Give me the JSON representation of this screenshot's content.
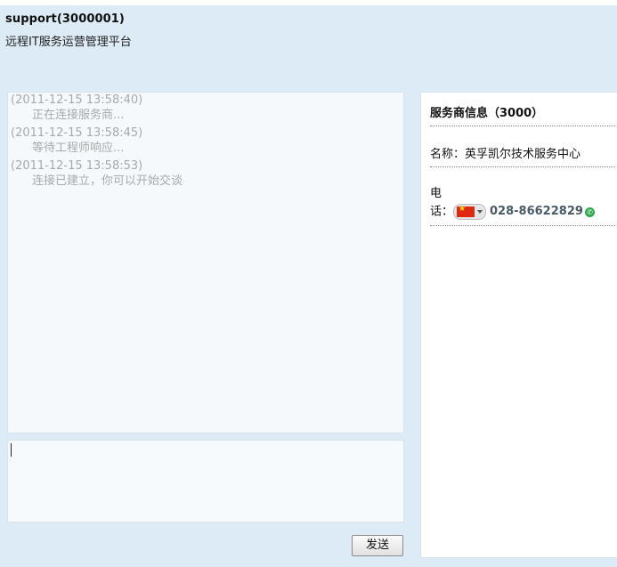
{
  "header": {
    "title": "support(3000001)",
    "subtitle": "远程IT服务运营管理平台"
  },
  "chat": {
    "messages": [
      {
        "time": "(2011-12-15 13:58:40)",
        "text": "正在连接服务商..."
      },
      {
        "time": "(2011-12-15 13:58:45)",
        "text": "等待工程师响应..."
      },
      {
        "time": "(2011-12-15 13:58:53)",
        "text": "连接已建立，你可以开始交谈"
      }
    ],
    "input_value": "",
    "send_label": "发送"
  },
  "provider": {
    "title": "服务商信息（3000）",
    "name_row": "名称：英孚凯尔技术服务中心",
    "phone_label_line1": "电",
    "phone_label_line2": "话：",
    "phone_country_icon": "china-flag-icon",
    "phone_number": "028-86622829",
    "call_icon": "phone-call-icon"
  },
  "colors": {
    "background": "#dcebf6",
    "message_text": "#a9a9a9",
    "call_green": "#2ea84a"
  }
}
